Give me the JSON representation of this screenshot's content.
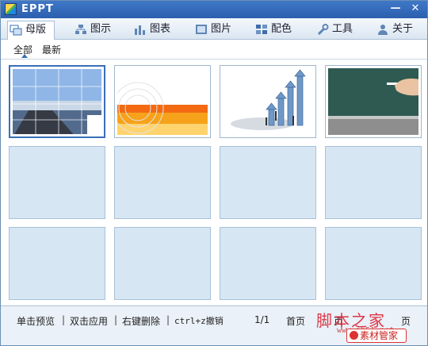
{
  "window": {
    "title": "EPPT",
    "min_glyph": "—",
    "close_glyph": "✕"
  },
  "toolbar": {
    "tabs": [
      {
        "label": "母版",
        "icon": "template-icon"
      },
      {
        "label": "图示",
        "icon": "diagram-icon"
      },
      {
        "label": "图表",
        "icon": "bar-chart-icon"
      },
      {
        "label": "图片",
        "icon": "picture-icon"
      },
      {
        "label": "配色",
        "icon": "palette-icon"
      },
      {
        "label": "工具",
        "icon": "wrench-icon"
      },
      {
        "label": "关于",
        "icon": "person-icon"
      }
    ],
    "active_tab": "母版"
  },
  "filters": {
    "all": "全部",
    "recent": "最新"
  },
  "statusbar": {
    "hint1": "单击预览",
    "hint2": "双击应用",
    "hint3": "右键删除",
    "hint4": "ctrl+z撤销",
    "sep": "|",
    "page": "1/1",
    "first": "首页",
    "next_partial": "页",
    "last_partial": "页"
  },
  "watermark": {
    "text": "脚本之家",
    "url": "www.jb51.net",
    "badge": "素材管家"
  },
  "colors": {
    "accent": "#3a6fb7",
    "tile_empty": "#d6e6f2",
    "watermark": "#dd2233"
  }
}
